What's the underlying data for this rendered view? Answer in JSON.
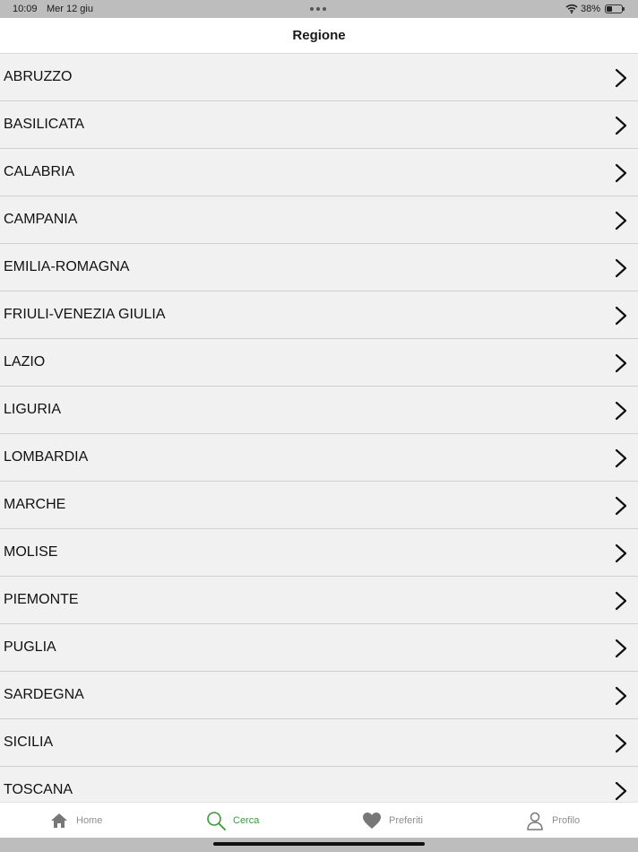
{
  "status_bar": {
    "time": "10:09",
    "date": "Mer 12 giu",
    "battery": "38%",
    "battery_level": 0.38
  },
  "nav": {
    "title": "Regione"
  },
  "regions": [
    "ABRUZZO",
    "BASILICATA",
    "CALABRIA",
    "CAMPANIA",
    "EMILIA-ROMAGNA",
    "FRIULI-VENEZIA GIULIA",
    "LAZIO",
    "LIGURIA",
    "LOMBARDIA",
    "MARCHE",
    "MOLISE",
    "PIEMONTE",
    "PUGLIA",
    "SARDEGNA",
    "SICILIA",
    "TOSCANA"
  ],
  "row_icon": "chevron-right-icon",
  "tabs": [
    {
      "label": "Home",
      "icon": "home-icon",
      "active": false
    },
    {
      "label": "Cerca",
      "icon": "search-icon",
      "active": true
    },
    {
      "label": "Preferiti",
      "icon": "heart-icon",
      "active": false
    },
    {
      "label": "Profilo",
      "icon": "person-icon",
      "active": false
    }
  ],
  "colors": {
    "accent": "#3a9a3a",
    "inactive": "#8e8e8e",
    "list_background": "#f1f1f1"
  }
}
